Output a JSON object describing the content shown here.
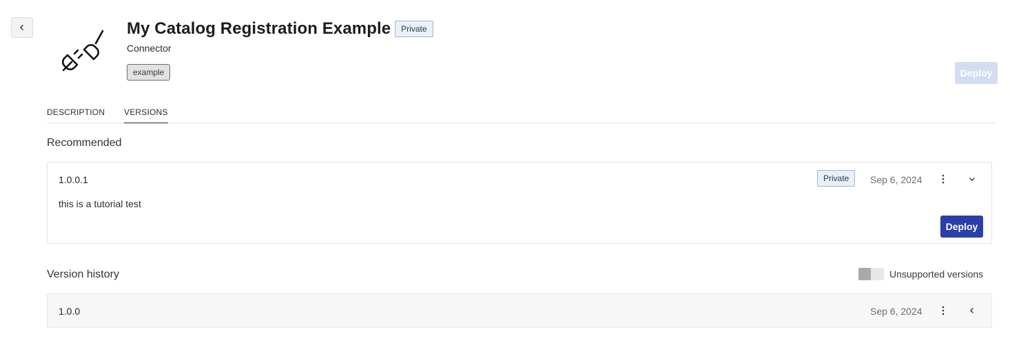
{
  "header": {
    "back_icon": "chevron-left-icon",
    "logo_icon": "plug-connector-icon",
    "title": "My Catalog Registration Example",
    "visibility_badge": "Private",
    "subtitle": "Connector",
    "tag": "example",
    "deploy_label": "Deploy"
  },
  "tabs": [
    {
      "label": "DESCRIPTION",
      "active": false
    },
    {
      "label": "VERSIONS",
      "active": true
    }
  ],
  "recommended": {
    "section_title": "Recommended",
    "version": "1.0.0.1",
    "badge": "Private",
    "date": "Sep 6, 2024",
    "description": "this is a tutorial test",
    "deploy_label": "Deploy",
    "menu_icon": "kebab-menu-icon",
    "expand_icon": "chevron-down-icon"
  },
  "history": {
    "section_title": "Version history",
    "toggle_label": "Unsupported versions",
    "toggle_on": false,
    "rows": [
      {
        "version": "1.0.0",
        "date": "Sep 6, 2024",
        "menu_icon": "kebab-menu-icon",
        "expand_icon": "chevron-left-icon"
      }
    ]
  },
  "colors": {
    "primary": "#2b3fa9",
    "primary_disabled": "#d4dcf0",
    "badge_bg": "#e9f0f8",
    "badge_border": "#9fb6d3"
  }
}
